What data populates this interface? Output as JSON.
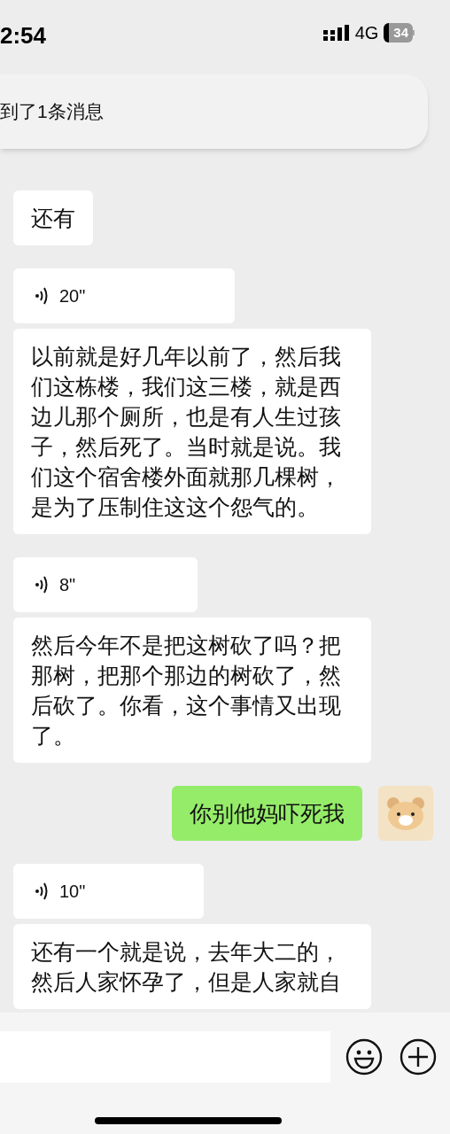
{
  "status_bar": {
    "time": "2:54",
    "network": "4G",
    "battery": "34"
  },
  "notification": {
    "text": "到了1条消息"
  },
  "messages": [
    {
      "kind": "text",
      "from_me": false,
      "text": "还有"
    },
    {
      "kind": "voice",
      "from_me": false,
      "duration": "20\""
    },
    {
      "kind": "text",
      "from_me": false,
      "text": "以前就是好几年以前了，然后我们这栋楼，我们这三楼，就是西边儿那个厕所，也是有人生过孩子，然后死了。当时就是说。我们这个宿舍楼外面就那几棵树，是为了压制住这这个怨气的。"
    },
    {
      "kind": "voice",
      "from_me": false,
      "duration": "8\""
    },
    {
      "kind": "text",
      "from_me": false,
      "text": "然后今年不是把这树砍了吗？把那树，把那个那边的树砍了，然后砍了。你看，这个事情又出现了。"
    },
    {
      "kind": "text",
      "from_me": true,
      "text": "你别他妈吓死我"
    },
    {
      "kind": "voice",
      "from_me": false,
      "duration": "10\""
    },
    {
      "kind": "text",
      "from_me": false,
      "text": "还有一个就是说，去年大二的，然后人家怀孕了，但是人家就自"
    }
  ]
}
